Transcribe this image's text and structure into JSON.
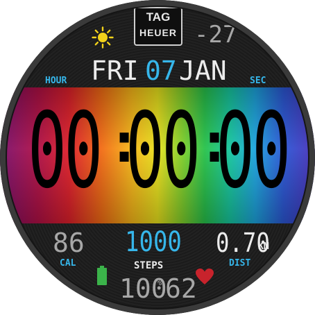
{
  "brand": {
    "line1": "TAG",
    "line2": "HEUER"
  },
  "weather": {
    "icon": "sun-icon",
    "temperature": "-27°"
  },
  "date": {
    "day": "FRI",
    "date": "07",
    "month": "JAN"
  },
  "labels": {
    "hour": "HOUR",
    "sec": "SEC"
  },
  "time": {
    "hours": "00",
    "minutes": "00",
    "seconds": "00",
    "sep1": ":",
    "sep2": ":"
  },
  "stats": {
    "calories": {
      "value": "86",
      "label": "CAL"
    },
    "steps": {
      "value": "1000",
      "label": "STEPS"
    },
    "distance": {
      "value": "0.70",
      "unit": "KM",
      "label": "DIST"
    }
  },
  "battery": {
    "icon": "battery-icon",
    "value": "100",
    "unit": "%"
  },
  "heart_rate": {
    "icon": "heart-icon",
    "value": "62"
  },
  "colors": {
    "accent": "#36b6ea",
    "battery": "#3bb34a",
    "heart": "#c8232c",
    "sun": "#f2d21a"
  }
}
